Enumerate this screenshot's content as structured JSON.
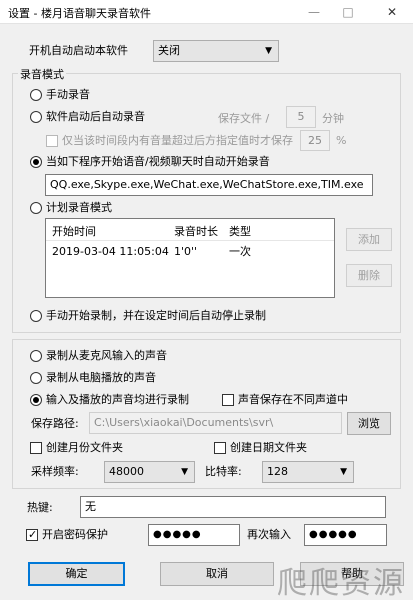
{
  "window": {
    "title": "设置 - 楼月语音聊天录音软件",
    "controls": [
      "—",
      "□",
      "✕"
    ]
  },
  "autostart": {
    "label": "开机自动启动本软件",
    "value": "关闭"
  },
  "record_mode": {
    "group_title": "录音模式",
    "manual": "手动录音",
    "auto_after_start": "软件启动后自动录音",
    "save_file_label": "保存文件 /",
    "save_minutes": "5",
    "minutes_unit": "分钟",
    "volume_check_label": "仅当该时间段内有音量超过后方指定值时才保存",
    "volume_percent": "25",
    "percent_unit": "%",
    "on_program": "当如下程序开始语音/视频聊天时自动开始录音",
    "program_list": "QQ.exe,Skype.exe,WeChat.exe,WeChatStore.exe,TIM.exe",
    "scheduled": "计划录音模式",
    "schedule_columns": [
      "开始时间",
      "录音时长",
      "类型"
    ],
    "schedule_rows": [
      {
        "start": "2019-03-04 11:05:04",
        "duration": "1'0''",
        "type": "一次"
      }
    ],
    "add_button": "添加",
    "delete_button": "删除",
    "manual_timed": "手动开始录制，并在设定时间后自动停止录制"
  },
  "source": {
    "mic": "录制从麦克风输入的声音",
    "speaker": "录制从电脑播放的声音",
    "both": "输入及播放的声音均进行录制",
    "separate_channel": "声音保存在不同声道中",
    "save_path_label": "保存路径:",
    "save_path": "C:\\Users\\xiaokai\\Documents\\svr\\",
    "browse_button": "浏览",
    "month_folder": "创建月份文件夹",
    "date_folder": "创建日期文件夹",
    "sample_rate_label": "采样频率:",
    "sample_rate": "48000",
    "bitrate_label": "比特率:",
    "bitrate": "128"
  },
  "hotkey": {
    "label": "热键:",
    "value": "无"
  },
  "password": {
    "enable_label": "开启密码保护",
    "value": "●●●●●",
    "confirm_label": "再次输入",
    "confirm_value": "●●●●●"
  },
  "buttons": {
    "ok": "确定",
    "cancel": "取消",
    "help": "帮助"
  },
  "watermark": "爬爬资源"
}
